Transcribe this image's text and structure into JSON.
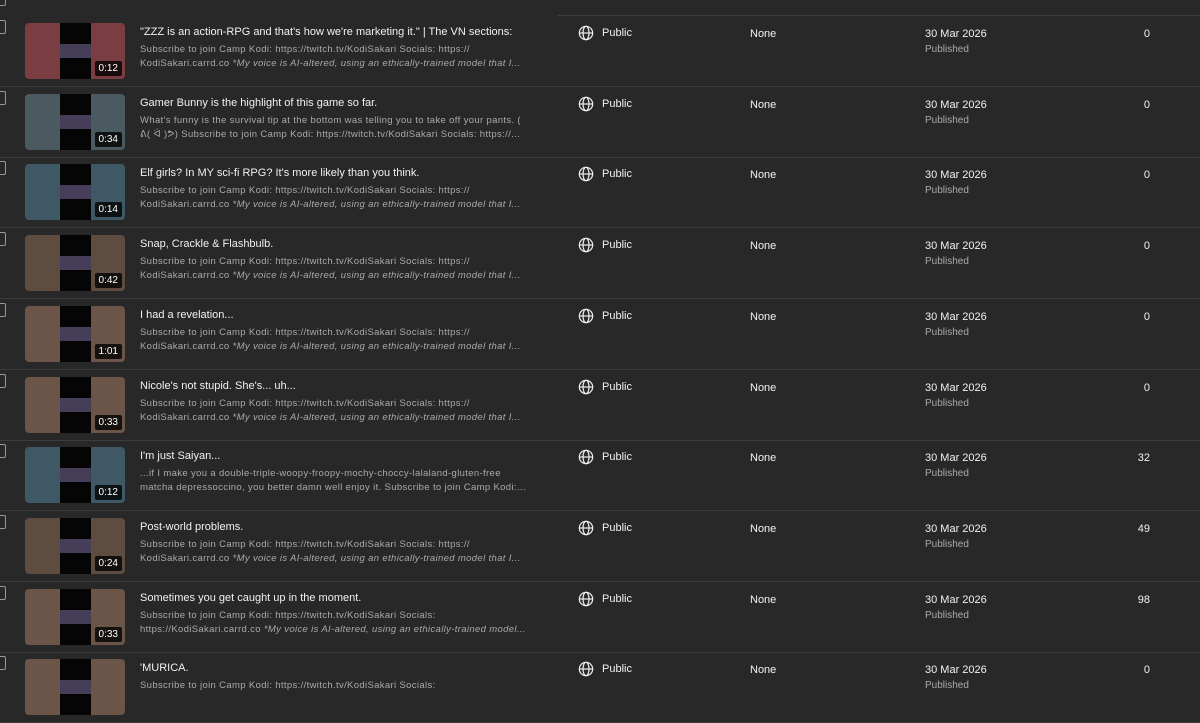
{
  "colors": {
    "background": "#282828",
    "text_primary": "#f1f1f1",
    "text_secondary": "#aaaaaa",
    "divider": "#3c3c3c"
  },
  "rows": [
    {
      "title": "\"ZZZ is an action-RPG and that's how we're marketing it.\" | The VN sections:",
      "desc_line1": "Subscribe to join Camp Kodi: https://twitch.tv/KodiSakari Socials: https://",
      "desc_line2_plain": "KodiSakari.carrd.co ",
      "desc_line2_italic": "*My voice is AI-altered, using an ethically-trained model that I...",
      "duration": "0:12",
      "visibility": "Public",
      "visibility_icon": "globe-icon",
      "restrictions": "None",
      "date": "30 Mar 2026",
      "status": "Published",
      "views": "0",
      "thumb_color": "#7a3e42"
    },
    {
      "title": "Gamer Bunny is the highlight of this game so far.",
      "desc_line1": "What's funny is the survival tip at the bottom was telling you to take off your pants. (",
      "desc_line2_plain": "ᕕ( ᐛ )ᕗ) Subscribe to join Camp Kodi: https://twitch.tv/KodiSakari Socials: https://...",
      "desc_line2_italic": "",
      "duration": "0:34",
      "visibility": "Public",
      "visibility_icon": "globe-icon",
      "restrictions": "None",
      "date": "30 Mar 2026",
      "status": "Published",
      "views": "0",
      "thumb_color": "#4b5a60"
    },
    {
      "title": "Elf girls? In MY sci-fi RPG? It's more likely than you think.",
      "desc_line1": "Subscribe to join Camp Kodi: https://twitch.tv/KodiSakari Socials: https://",
      "desc_line2_plain": "KodiSakari.carrd.co ",
      "desc_line2_italic": "*My voice is AI-altered, using an ethically-trained model that I...",
      "duration": "0:14",
      "visibility": "Public",
      "visibility_icon": "globe-icon",
      "restrictions": "None",
      "date": "30 Mar 2026",
      "status": "Published",
      "views": "0",
      "thumb_color": "#3f5866"
    },
    {
      "title": "Snap, Crackle & Flashbulb.",
      "desc_line1": "Subscribe to join Camp Kodi: https://twitch.tv/KodiSakari Socials: https://",
      "desc_line2_plain": "KodiSakari.carrd.co ",
      "desc_line2_italic": "*My voice is AI-altered, using an ethically-trained model that I...",
      "duration": "0:42",
      "visibility": "Public",
      "visibility_icon": "globe-icon",
      "restrictions": "None",
      "date": "30 Mar 2026",
      "status": "Published",
      "views": "0",
      "thumb_color": "#5e4c40"
    },
    {
      "title": "I had a revelation...",
      "desc_line1": "Subscribe to join Camp Kodi: https://twitch.tv/KodiSakari Socials: https://",
      "desc_line2_plain": "KodiSakari.carrd.co ",
      "desc_line2_italic": "*My voice is AI-altered, using an ethically-trained model that I...",
      "duration": "1:01",
      "visibility": "Public",
      "visibility_icon": "globe-icon",
      "restrictions": "None",
      "date": "30 Mar 2026",
      "status": "Published",
      "views": "0",
      "thumb_color": "#6a5548"
    },
    {
      "title": "Nicole's not stupid. She's... uh...",
      "desc_line1": "Subscribe to join Camp Kodi: https://twitch.tv/KodiSakari Socials: https://",
      "desc_line2_plain": "KodiSakari.carrd.co ",
      "desc_line2_italic": "*My voice is AI-altered, using an ethically-trained model that I...",
      "duration": "0:33",
      "visibility": "Public",
      "visibility_icon": "globe-icon",
      "restrictions": "None",
      "date": "30 Mar 2026",
      "status": "Published",
      "views": "0",
      "thumb_color": "#6a5548"
    },
    {
      "title": "I'm just Saiyan...",
      "desc_line1": "...if I make you a double-triple-woopy-froopy-mochy-choccy-lalaland-gluten-free",
      "desc_line2_plain": "matcha depressoccino, you better damn well enjoy it. Subscribe to join Camp Kodi:...",
      "desc_line2_italic": "",
      "duration": "0:12",
      "visibility": "Public",
      "visibility_icon": "globe-icon",
      "restrictions": "None",
      "date": "30 Mar 2026",
      "status": "Published",
      "views": "32",
      "thumb_color": "#3f5866"
    },
    {
      "title": "Post-world problems.",
      "desc_line1": "Subscribe to join Camp Kodi: https://twitch.tv/KodiSakari Socials: https://",
      "desc_line2_plain": "KodiSakari.carrd.co ",
      "desc_line2_italic": "*My voice is AI-altered, using an ethically-trained model that I...",
      "duration": "0:24",
      "visibility": "Public",
      "visibility_icon": "globe-icon",
      "restrictions": "None",
      "date": "30 Mar 2026",
      "status": "Published",
      "views": "49",
      "thumb_color": "#5e4c40"
    },
    {
      "title": "Sometimes you get caught up in the moment.",
      "desc_line1": "Subscribe to join Camp Kodi: https://twitch.tv/KodiSakari Socials:",
      "desc_line2_plain": "https://KodiSakari.carrd.co ",
      "desc_line2_italic": "*My voice is AI-altered, using an ethically-trained model...",
      "duration": "0:33",
      "visibility": "Public",
      "visibility_icon": "globe-icon",
      "restrictions": "None",
      "date": "30 Mar 2026",
      "status": "Published",
      "views": "98",
      "thumb_color": "#6a5548"
    },
    {
      "title": "'MURICA.",
      "desc_line1": "Subscribe to join Camp Kodi: https://twitch.tv/KodiSakari Socials:",
      "desc_line2_plain": "",
      "desc_line2_italic": "",
      "duration": "",
      "visibility": "Public",
      "visibility_icon": "globe-icon",
      "restrictions": "None",
      "date": "30 Mar 2026",
      "status": "Published",
      "views": "0",
      "thumb_color": "#6a5548"
    }
  ]
}
